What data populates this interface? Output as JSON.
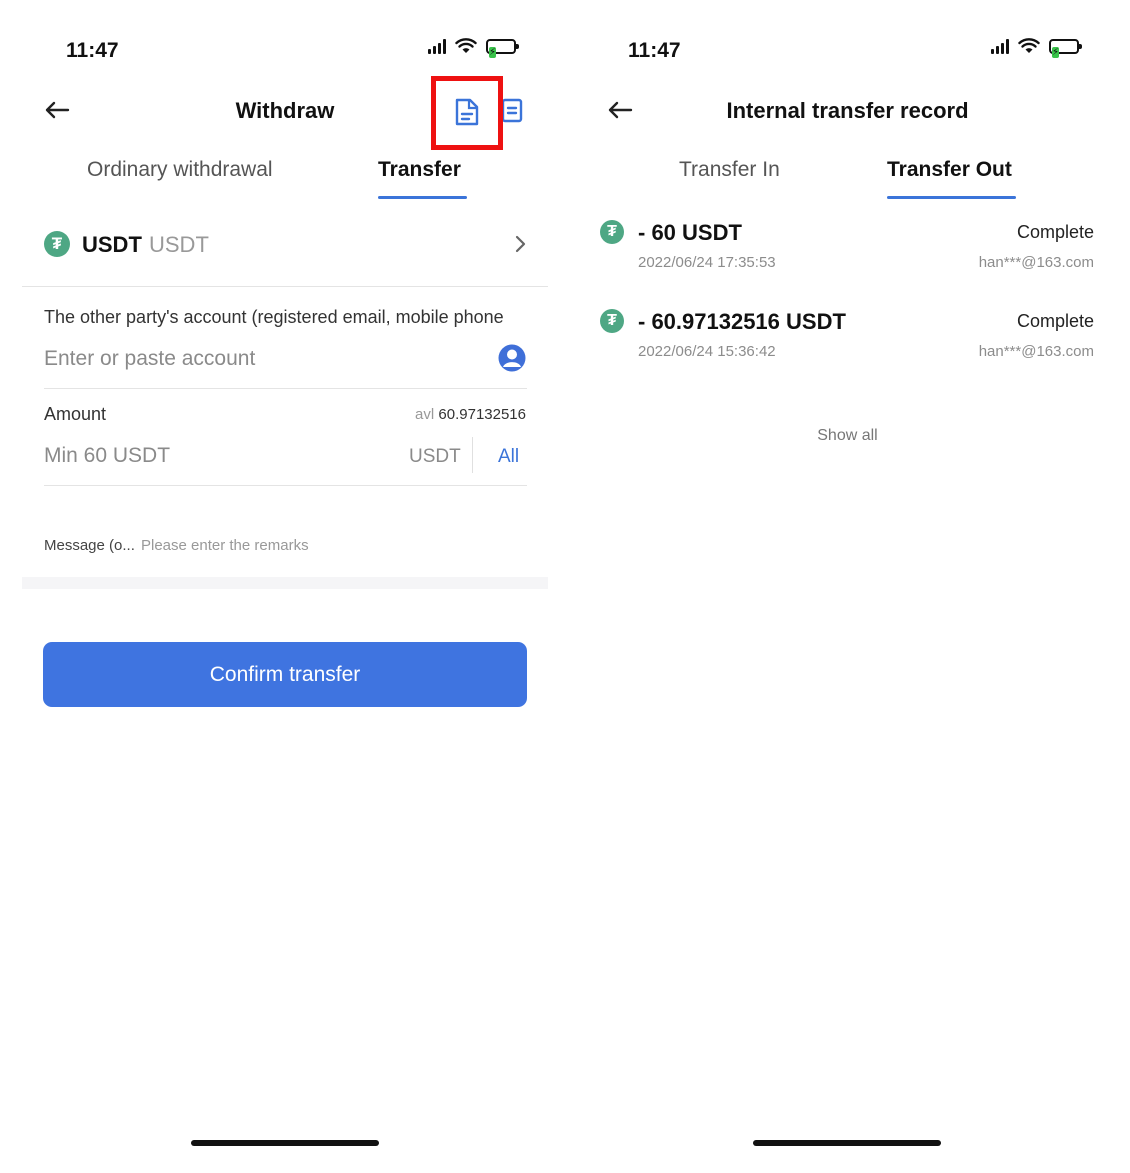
{
  "left_screen": {
    "status_time": "11:47",
    "nav_title": "Withdraw",
    "tabs": [
      {
        "label": "Ordinary withdrawal",
        "active": false
      },
      {
        "label": "Transfer",
        "active": true
      }
    ],
    "coin": {
      "name": "USDT",
      "sub": "USDT",
      "icon": "tether-icon",
      "color": "#4ea784"
    },
    "account_field": {
      "label": "The other party's account (registered email, mobile phone",
      "placeholder": "Enter or paste account",
      "icon": "contact-icon"
    },
    "amount_field": {
      "label": "Amount",
      "available_prefix": "avl",
      "available_value": "60.97132516",
      "placeholder": "Min 60 USDT",
      "unit": "USDT",
      "all_label": "All"
    },
    "message_field": {
      "label": "Message (o...",
      "placeholder": "Please enter the remarks"
    },
    "confirm_label": "Confirm transfer",
    "highlight_color": "#ee1111",
    "accent_color": "#3f74e0"
  },
  "right_screen": {
    "status_time": "11:47",
    "nav_title": "Internal transfer record",
    "tabs": [
      {
        "label": "Transfer In",
        "active": false
      },
      {
        "label": "Transfer Out",
        "active": true
      }
    ],
    "records": [
      {
        "amount": "- 60 USDT",
        "time": "2022/06/24 17:35:53",
        "status": "Complete",
        "account": "han***@163.com"
      },
      {
        "amount": "- 60.97132516 USDT",
        "time": "2022/06/24 15:36:42",
        "status": "Complete",
        "account": "han***@163.com"
      }
    ],
    "show_all_label": "Show all"
  }
}
